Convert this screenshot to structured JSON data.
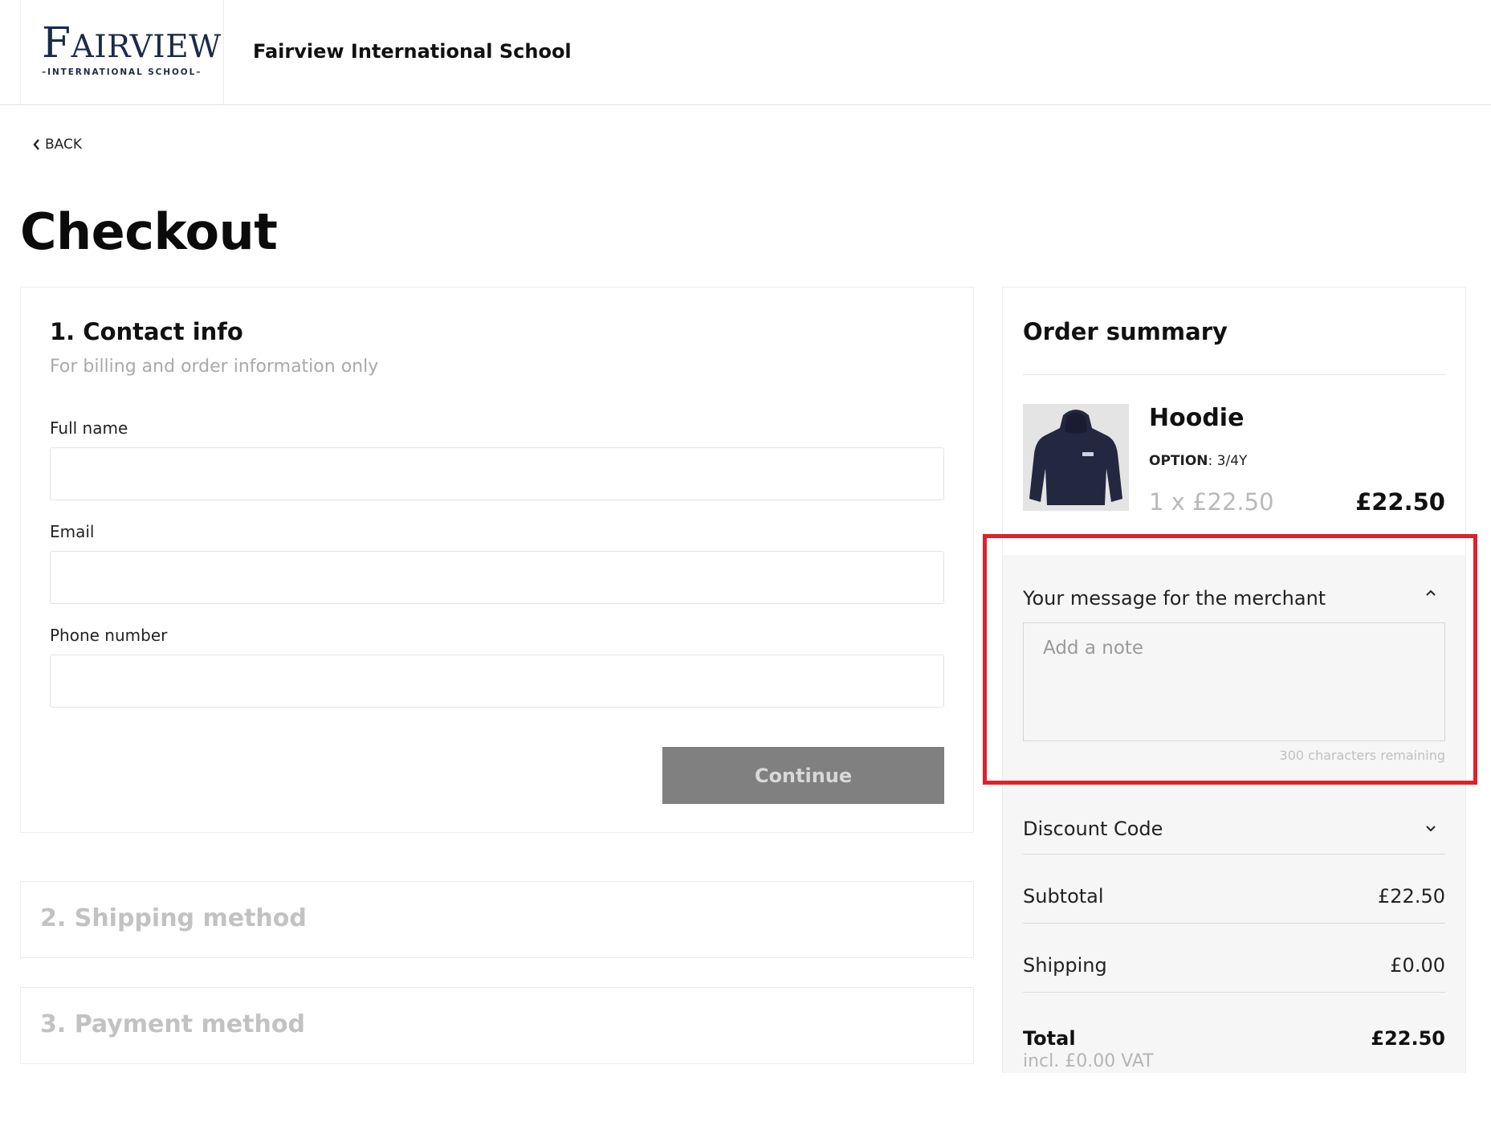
{
  "header": {
    "logo_main_first": "F",
    "logo_main_rest": "AIRVIEW",
    "logo_sub": "–INTERNATIONAL SCHOOL–",
    "school_name": "Fairview International School"
  },
  "nav": {
    "back_label": "BACK"
  },
  "page": {
    "title": "Checkout"
  },
  "contact": {
    "title": "1. Contact info",
    "subtitle": "For billing and order information only",
    "fields": [
      {
        "label": "Full name",
        "value": ""
      },
      {
        "label": "Email",
        "value": ""
      },
      {
        "label": "Phone number",
        "value": ""
      }
    ],
    "continue_label": "Continue"
  },
  "steps": {
    "shipping_label": "2. Shipping method",
    "payment_label": "3. Payment method"
  },
  "summary": {
    "title": "Order summary",
    "product": {
      "name": "Hoodie",
      "option_key": "OPTION",
      "option_value": ": 3/4Y",
      "qty_price": "1 x £22.50",
      "line_total": "£22.50",
      "image_icon": "hoodie-image"
    },
    "message": {
      "title": "Your message for the merchant",
      "placeholder": "Add a note",
      "value": "",
      "chars_remaining": "300 characters remaining",
      "expanded": true
    },
    "discount": {
      "title": "Discount Code",
      "expanded": false
    },
    "subtotal_label": "Subtotal",
    "subtotal_value": "£22.50",
    "shipping_label": "Shipping",
    "shipping_value": "£0.00",
    "total_label": "Total",
    "total_value": "£22.50",
    "vat_note": "incl. £0.00 VAT"
  },
  "colors": {
    "highlight": "#e0202a",
    "button_disabled": "#808080",
    "logo_navy": "#1b2a4a"
  }
}
